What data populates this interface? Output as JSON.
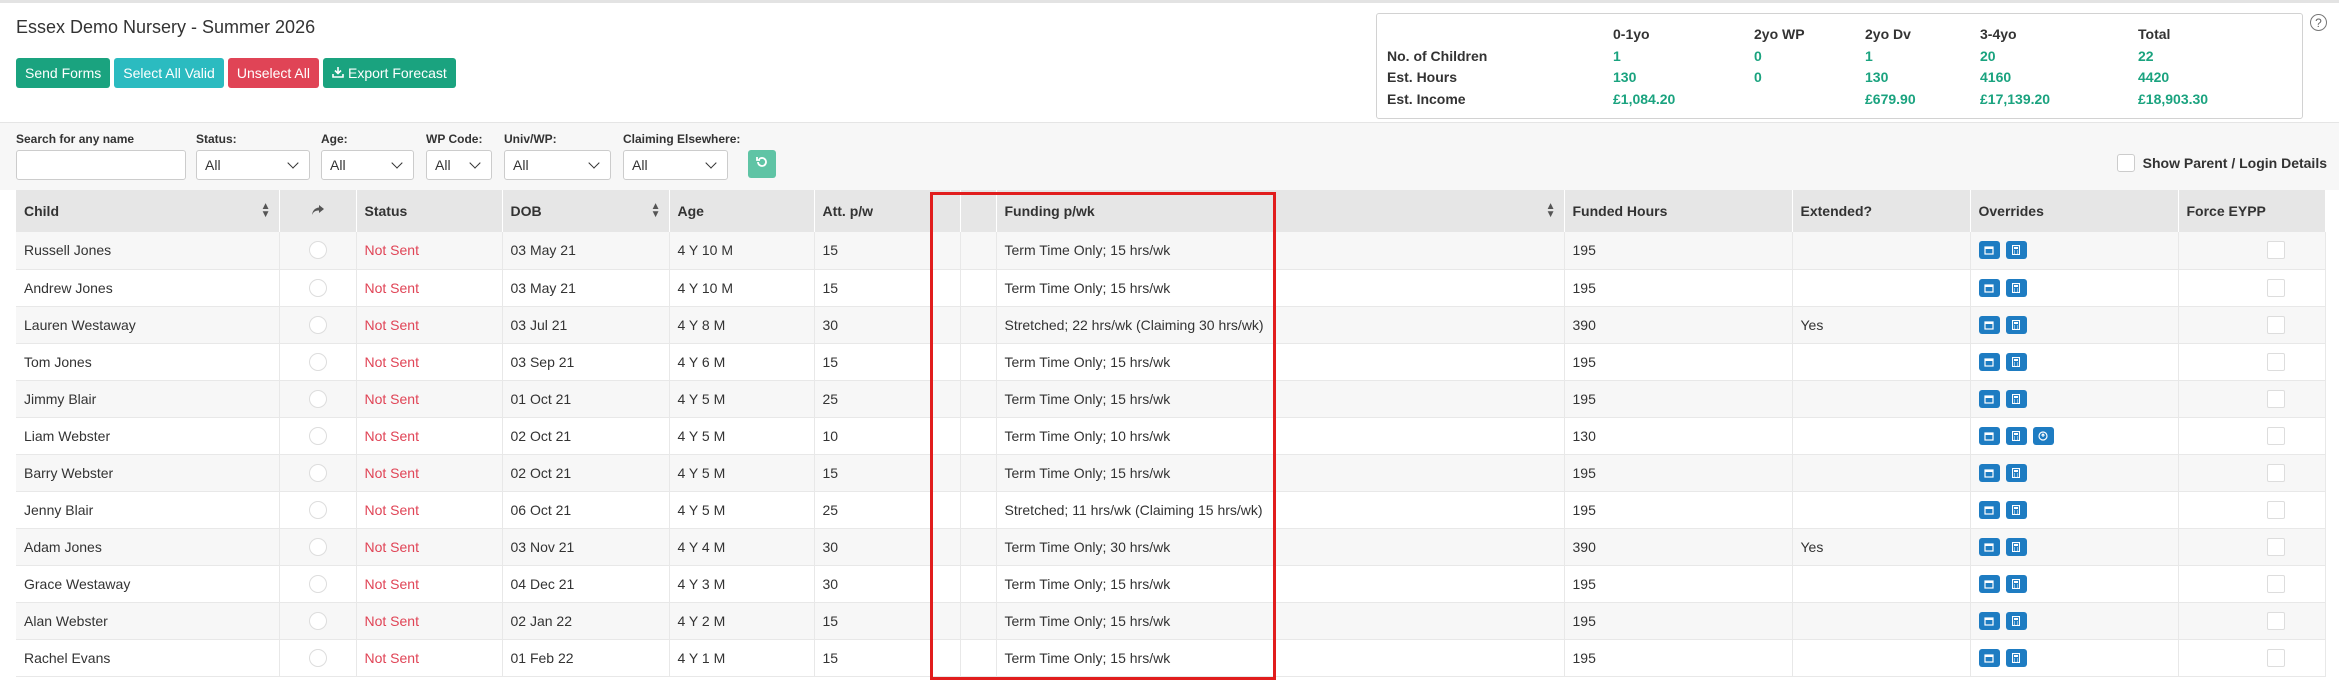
{
  "title": "Essex Demo Nursery - Summer 2026",
  "actions": {
    "send_forms": "Send Forms",
    "select_all_valid": "Select All Valid",
    "unselect_all": "Unselect All",
    "export_forecast": "Export Forecast"
  },
  "summary": {
    "headers": [
      "0-1yo",
      "2yo WP",
      "2yo Dv",
      "3-4yo",
      "Total"
    ],
    "rows": [
      {
        "label": "No. of Children",
        "values": [
          "1",
          "0",
          "1",
          "20",
          "22"
        ]
      },
      {
        "label": "Est. Hours",
        "values": [
          "130",
          "0",
          "130",
          "4160",
          "4420"
        ]
      },
      {
        "label": "Est. Income",
        "values": [
          "£1,084.20",
          "",
          "£679.90",
          "£17,139.20",
          "£18,903.30"
        ]
      }
    ]
  },
  "filters": {
    "search_label": "Search for any name",
    "search_value": "",
    "status_label": "Status:",
    "status_value": "All",
    "age_label": "Age:",
    "age_value": "All",
    "wp_label": "WP Code:",
    "wp_value": "All",
    "univ_label": "Univ/WP:",
    "univ_value": "All",
    "claiming_label": "Claiming Elsewhere:",
    "claiming_value": "All",
    "show_parent_label": "Show Parent / Login Details"
  },
  "table": {
    "columns": [
      "Child",
      "",
      "Status",
      "DOB",
      "Age",
      "Att. p/w",
      "",
      "Funding p/wk",
      "Funded Hours",
      "Extended?",
      "Overrides",
      "Force EYPP"
    ],
    "rows": [
      {
        "child": "Russell Jones",
        "status": "Not Sent",
        "dob": "03 May 21",
        "age": "4 Y 10 M",
        "att": "15",
        "funding": "Term Time Only; 15 hrs/wk",
        "hours": "195",
        "extended": "",
        "extra_override": false
      },
      {
        "child": "Andrew Jones",
        "status": "Not Sent",
        "dob": "03 May 21",
        "age": "4 Y 10 M",
        "att": "15",
        "funding": "Term Time Only; 15 hrs/wk",
        "hours": "195",
        "extended": "",
        "extra_override": false
      },
      {
        "child": "Lauren Westaway",
        "status": "Not Sent",
        "dob": "03 Jul 21",
        "age": "4 Y 8 M",
        "att": "30",
        "funding": "Stretched; 22 hrs/wk (Claiming 30 hrs/wk)",
        "hours": "390",
        "extended": "Yes",
        "extra_override": false
      },
      {
        "child": "Tom Jones",
        "status": "Not Sent",
        "dob": "03 Sep 21",
        "age": "4 Y 6 M",
        "att": "15",
        "funding": "Term Time Only; 15 hrs/wk",
        "hours": "195",
        "extended": "",
        "extra_override": false
      },
      {
        "child": "Jimmy Blair",
        "status": "Not Sent",
        "dob": "01 Oct 21",
        "age": "4 Y 5 M",
        "att": "25",
        "funding": "Term Time Only; 15 hrs/wk",
        "hours": "195",
        "extended": "",
        "extra_override": false
      },
      {
        "child": "Liam Webster",
        "status": "Not Sent",
        "dob": "02 Oct 21",
        "age": "4 Y 5 M",
        "att": "10",
        "funding": "Term Time Only; 10 hrs/wk",
        "hours": "130",
        "extended": "",
        "extra_override": true
      },
      {
        "child": "Barry Webster",
        "status": "Not Sent",
        "dob": "02 Oct 21",
        "age": "4 Y 5 M",
        "att": "15",
        "funding": "Term Time Only; 15 hrs/wk",
        "hours": "195",
        "extended": "",
        "extra_override": false
      },
      {
        "child": "Jenny Blair",
        "status": "Not Sent",
        "dob": "06 Oct 21",
        "age": "4 Y 5 M",
        "att": "25",
        "funding": "Stretched; 11 hrs/wk (Claiming 15 hrs/wk)",
        "hours": "195",
        "extended": "",
        "extra_override": false
      },
      {
        "child": "Adam Jones",
        "status": "Not Sent",
        "dob": "03 Nov 21",
        "age": "4 Y 4 M",
        "att": "30",
        "funding": "Term Time Only; 30 hrs/wk",
        "hours": "390",
        "extended": "Yes",
        "extra_override": false
      },
      {
        "child": "Grace Westaway",
        "status": "Not Sent",
        "dob": "04 Dec 21",
        "age": "4 Y 3 M",
        "att": "30",
        "funding": "Term Time Only; 15 hrs/wk",
        "hours": "195",
        "extended": "",
        "extra_override": false
      },
      {
        "child": "Alan Webster",
        "status": "Not Sent",
        "dob": "02 Jan 22",
        "age": "4 Y 2 M",
        "att": "15",
        "funding": "Term Time Only; 15 hrs/wk",
        "hours": "195",
        "extended": "",
        "extra_override": false
      },
      {
        "child": "Rachel Evans",
        "status": "Not Sent",
        "dob": "01 Feb 22",
        "age": "4 Y 1 M",
        "att": "15",
        "funding": "Term Time Only; 15 hrs/wk",
        "hours": "195",
        "extended": "",
        "extra_override": false
      }
    ]
  },
  "colors": {
    "accent_green": "#1aa37f",
    "accent_teal": "#2bbbc0",
    "danger_red": "#e04456",
    "override_blue": "#1e7cc2",
    "highlight_red": "#e11d1d"
  },
  "icons": {
    "export": "download-icon",
    "reset": "refresh-icon",
    "share": "share-arrow-icon",
    "help": "question-icon",
    "override_calendar": "calendar-icon",
    "override_calc": "calculator-icon",
    "override_extra": "circle-arrow-icon"
  }
}
